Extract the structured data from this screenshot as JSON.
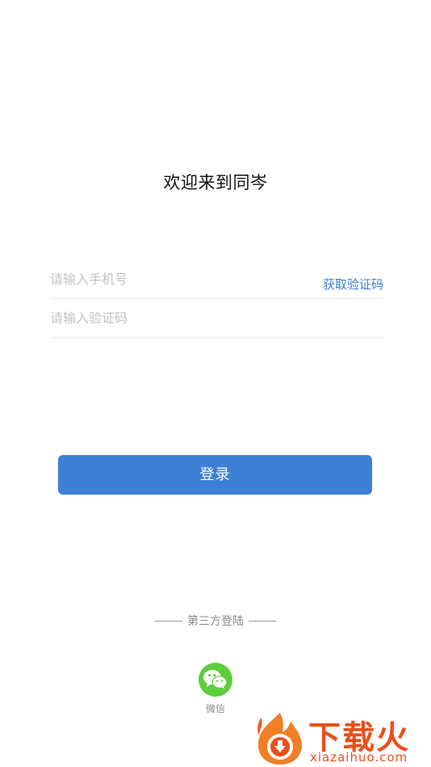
{
  "welcome_title": "欢迎来到同岑",
  "phone_field": {
    "placeholder": "请输入手机号",
    "get_code_label": "获取验证码"
  },
  "code_field": {
    "placeholder": "请输入验证码"
  },
  "login_button": {
    "label": "登录"
  },
  "third_party": {
    "label": "第三方登陆",
    "providers": [
      {
        "name": "微信",
        "icon": "wechat-icon"
      }
    ]
  },
  "watermark": {
    "text": "下载火",
    "domain": "xiazaihuo.com"
  },
  "colors": {
    "accent": "#3e80d6",
    "link": "#3a7ed8",
    "wechat": "#5ecd3b",
    "watermark": "#e94f1c"
  }
}
